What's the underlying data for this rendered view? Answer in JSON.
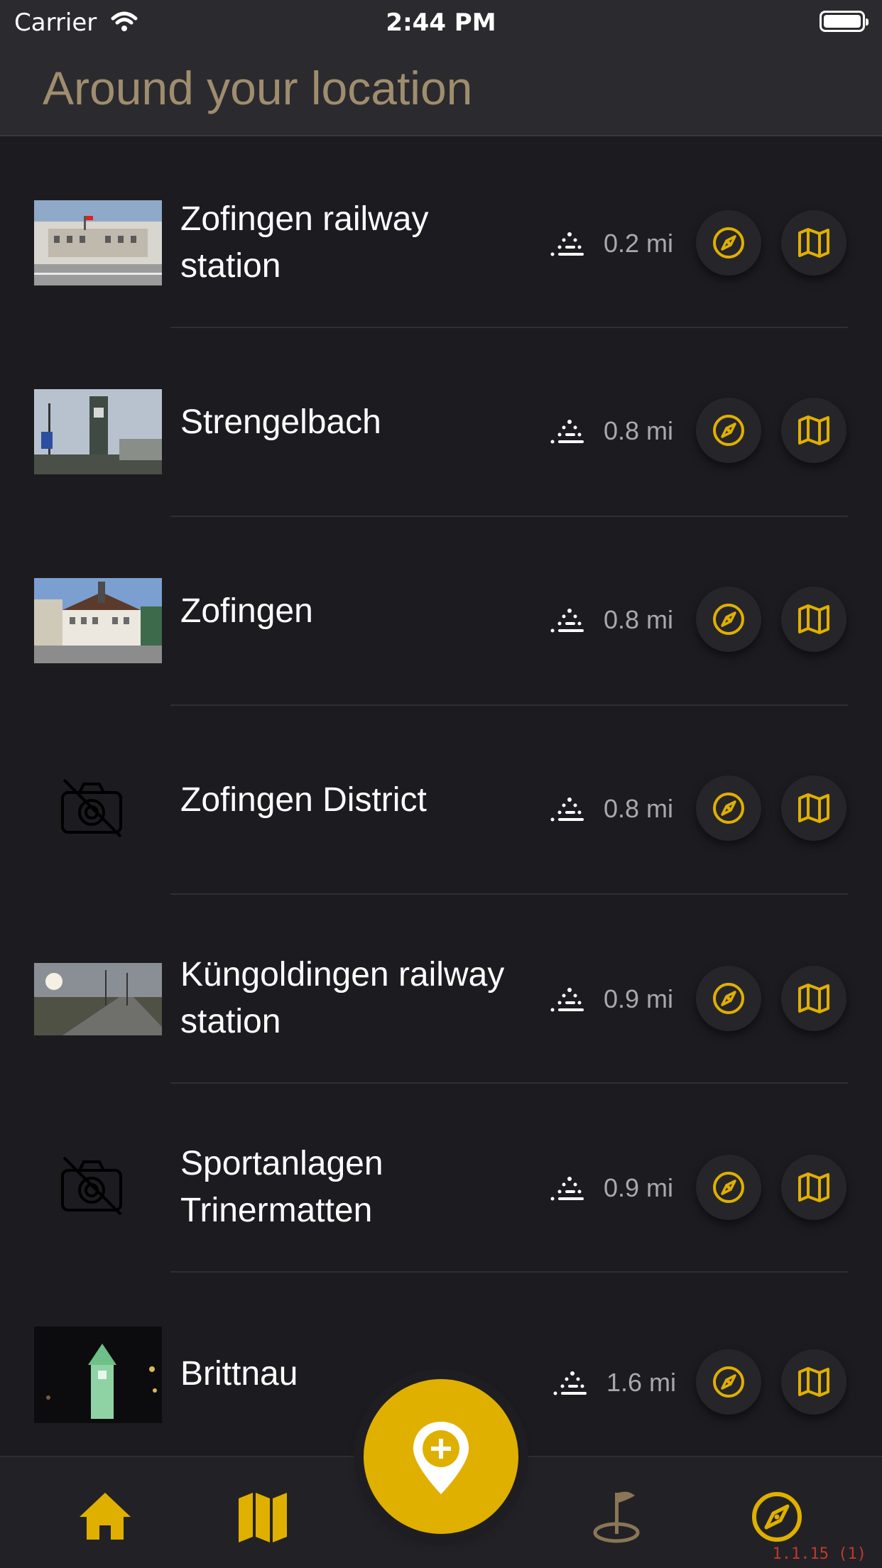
{
  "status_bar": {
    "carrier": "Carrier",
    "time": "2:44 PM"
  },
  "header": {
    "title": "Around your location"
  },
  "places": [
    {
      "name": "Zofingen railway station",
      "line1": "Zofingen railway",
      "line2": "station",
      "distance": "0.2 mi",
      "thumbnail": "photo"
    },
    {
      "name": "Strengelbach",
      "line1": "Strengelbach",
      "line2": "",
      "distance": "0.8 mi",
      "thumbnail": "photo"
    },
    {
      "name": "Zofingen",
      "line1": "Zofingen",
      "line2": "",
      "distance": "0.8 mi",
      "thumbnail": "photo"
    },
    {
      "name": "Zofingen District",
      "line1": "Zofingen District",
      "line2": "",
      "distance": "0.8 mi",
      "thumbnail": "no-photo"
    },
    {
      "name": "Küngoldingen railway station",
      "line1": "Küngoldingen railway",
      "line2": "station",
      "distance": "0.9 mi",
      "thumbnail": "photo"
    },
    {
      "name": "Sportanlagen Trinermatten",
      "line1": "Sportanlagen",
      "line2": "Trinermatten",
      "distance": "0.9 mi",
      "thumbnail": "no-photo"
    },
    {
      "name": "Brittnau",
      "line1": "Brittnau",
      "line2": "",
      "distance": "1.6 mi",
      "thumbnail": "photo"
    }
  ],
  "row_icons": {
    "walk": "walking-distance-icon",
    "compass": "compass-icon",
    "map": "map-icon"
  },
  "tabbar": {
    "tabs": [
      {
        "icon": "home-icon"
      },
      {
        "icon": "map-icon"
      },
      {
        "icon": "add-location-icon"
      },
      {
        "icon": "flag-location-icon"
      },
      {
        "icon": "compass-icon"
      }
    ]
  },
  "version": "1.1.15 (1)",
  "colors": {
    "accent": "#e0b000",
    "background": "#1c1c20",
    "header_title": "#9f8d6e"
  }
}
